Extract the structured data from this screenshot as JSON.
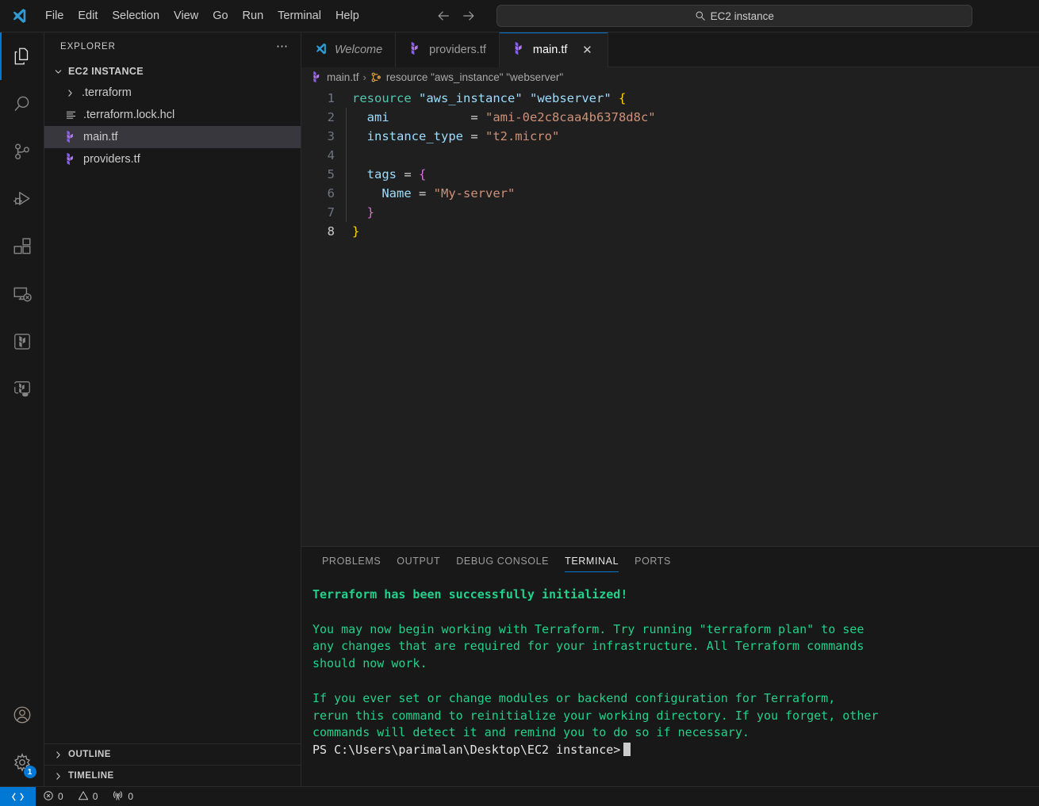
{
  "titlebar": {
    "logo_icon": "vscode-logo-icon",
    "menus": [
      "File",
      "Edit",
      "Selection",
      "View",
      "Go",
      "Run",
      "Terminal",
      "Help"
    ],
    "back_icon": "arrow-left-icon",
    "forward_icon": "arrow-right-icon",
    "command_center": {
      "search_icon": "search-icon",
      "value": "EC2 instance"
    }
  },
  "activitybar": {
    "items": [
      {
        "icon": "files-explorer-icon",
        "label": "Explorer",
        "active": true
      },
      {
        "icon": "search-icon",
        "label": "Search",
        "active": false
      },
      {
        "icon": "source-control-icon",
        "label": "Source Control",
        "active": false
      },
      {
        "icon": "run-and-debug-icon",
        "label": "Run and Debug",
        "active": false
      },
      {
        "icon": "extensions-icon",
        "label": "Extensions",
        "active": false
      },
      {
        "icon": "remote-explorer-icon",
        "label": "Remote Explorer",
        "active": false
      },
      {
        "icon": "terraform-icon",
        "label": "Terraform",
        "active": false
      },
      {
        "icon": "terraform-cloud-icon",
        "label": "Terraform Cloud",
        "active": false
      }
    ],
    "bottom": [
      {
        "icon": "account-icon",
        "label": "Accounts",
        "badge": ""
      },
      {
        "icon": "gear-icon",
        "label": "Manage",
        "badge": "1"
      }
    ]
  },
  "sidebar": {
    "title": "EXPLORER",
    "more_actions_icon": "ellipsis-icon",
    "root": {
      "label": "EC2 INSTANCE",
      "chevron_icon": "chevron-down-icon",
      "expanded": true
    },
    "files": [
      {
        "label": ".terraform",
        "icon": "folder-icon",
        "chevron_icon": "chevron-right-icon",
        "type": "folder",
        "selected": false
      },
      {
        "label": ".terraform.lock.hcl",
        "icon": "hcl-file-icon",
        "type": "file",
        "selected": false
      },
      {
        "label": "main.tf",
        "icon": "terraform-file-icon",
        "type": "file",
        "selected": true
      },
      {
        "label": "providers.tf",
        "icon": "terraform-file-icon",
        "type": "file",
        "selected": false
      }
    ],
    "sections": [
      {
        "label": "OUTLINE",
        "chevron_icon": "chevron-right-icon"
      },
      {
        "label": "TIMELINE",
        "chevron_icon": "chevron-right-icon"
      }
    ]
  },
  "editor": {
    "tabs": [
      {
        "label": "Welcome",
        "icon": "vscode-logo-icon",
        "active": false,
        "preview": true,
        "closable": false
      },
      {
        "label": "providers.tf",
        "icon": "terraform-file-icon",
        "active": false,
        "preview": false,
        "closable": false
      },
      {
        "label": "main.tf",
        "icon": "terraform-file-icon",
        "active": true,
        "preview": false,
        "closable": true,
        "close_icon": "close-icon"
      }
    ],
    "breadcrumbs": [
      {
        "label": "main.tf",
        "icon": "terraform-file-icon"
      },
      {
        "label": "resource \"aws_instance\" \"webserver\"",
        "icon": "symbol-struct-icon"
      }
    ],
    "separator": "›",
    "language": "Terraform",
    "lines": [
      {
        "n": "1",
        "tokens": [
          {
            "t": "resource",
            "c": "k-res"
          },
          {
            "t": " ",
            "c": "k-eq"
          },
          {
            "t": "\"aws_instance\"",
            "c": "k-str-blue"
          },
          {
            "t": " ",
            "c": "k-eq"
          },
          {
            "t": "\"webserver\"",
            "c": "k-str-blue"
          },
          {
            "t": " ",
            "c": "k-eq"
          },
          {
            "t": "{",
            "c": "k-brace-y"
          }
        ]
      },
      {
        "n": "2",
        "guide": true,
        "tokens": [
          {
            "t": "  ami           ",
            "c": "k-attr"
          },
          {
            "t": "= ",
            "c": "k-eq"
          },
          {
            "t": "\"ami-0e2c8caa4b6378d8c\"",
            "c": "k-str"
          }
        ]
      },
      {
        "n": "3",
        "guide": true,
        "tokens": [
          {
            "t": "  instance_type ",
            "c": "k-attr"
          },
          {
            "t": "= ",
            "c": "k-eq"
          },
          {
            "t": "\"t2.micro\"",
            "c": "k-str"
          }
        ]
      },
      {
        "n": "4",
        "guide": true,
        "tokens": []
      },
      {
        "n": "5",
        "guide": true,
        "tokens": [
          {
            "t": "  tags ",
            "c": "k-attr"
          },
          {
            "t": "= ",
            "c": "k-eq"
          },
          {
            "t": "{",
            "c": "k-brace-p"
          }
        ]
      },
      {
        "n": "6",
        "guide": true,
        "tokens": [
          {
            "t": "    Name ",
            "c": "k-attr"
          },
          {
            "t": "= ",
            "c": "k-eq"
          },
          {
            "t": "\"My-server\"",
            "c": "k-str"
          }
        ]
      },
      {
        "n": "7",
        "guide": true,
        "tokens": [
          {
            "t": "  ",
            "c": "k-eq"
          },
          {
            "t": "}",
            "c": "k-brace-p"
          }
        ]
      },
      {
        "n": "8",
        "current": true,
        "tokens": [
          {
            "t": "}",
            "c": "k-brace-y"
          }
        ]
      }
    ]
  },
  "panel": {
    "tabs": [
      {
        "label": "PROBLEMS",
        "active": false
      },
      {
        "label": "OUTPUT",
        "active": false
      },
      {
        "label": "DEBUG CONSOLE",
        "active": false
      },
      {
        "label": "TERMINAL",
        "active": true
      },
      {
        "label": "PORTS",
        "active": false
      }
    ],
    "terminal": {
      "heading": "Terraform has been successfully initialized!",
      "blank1": "",
      "para1_l1": "You may now begin working with Terraform. Try running \"terraform plan\" to see",
      "para1_l2": "any changes that are required for your infrastructure. All Terraform commands",
      "para1_l3": "should now work.",
      "blank2": "",
      "para2_l1": "If you ever set or change modules or backend configuration for Terraform,",
      "para2_l2": "rerun this command to reinitialize your working directory. If you forget, other",
      "para2_l3": "commands will detect it and remind you to do so if necessary.",
      "prompt": "PS C:\\Users\\parimalan\\Desktop\\EC2 instance>"
    }
  },
  "statusbar": {
    "remote_icon": "remote-window-icon",
    "items": [
      {
        "icon": "error-icon",
        "value": "0",
        "name": "errors"
      },
      {
        "icon": "warning-icon",
        "value": "0",
        "name": "warnings"
      },
      {
        "icon": "radio-tower-icon",
        "value": "0",
        "name": "ports"
      }
    ]
  },
  "colors": {
    "accent": "#0078d4",
    "terminal_green": "#23d18b",
    "selection": "#37373d",
    "terraform_purple": "#a972e8"
  }
}
